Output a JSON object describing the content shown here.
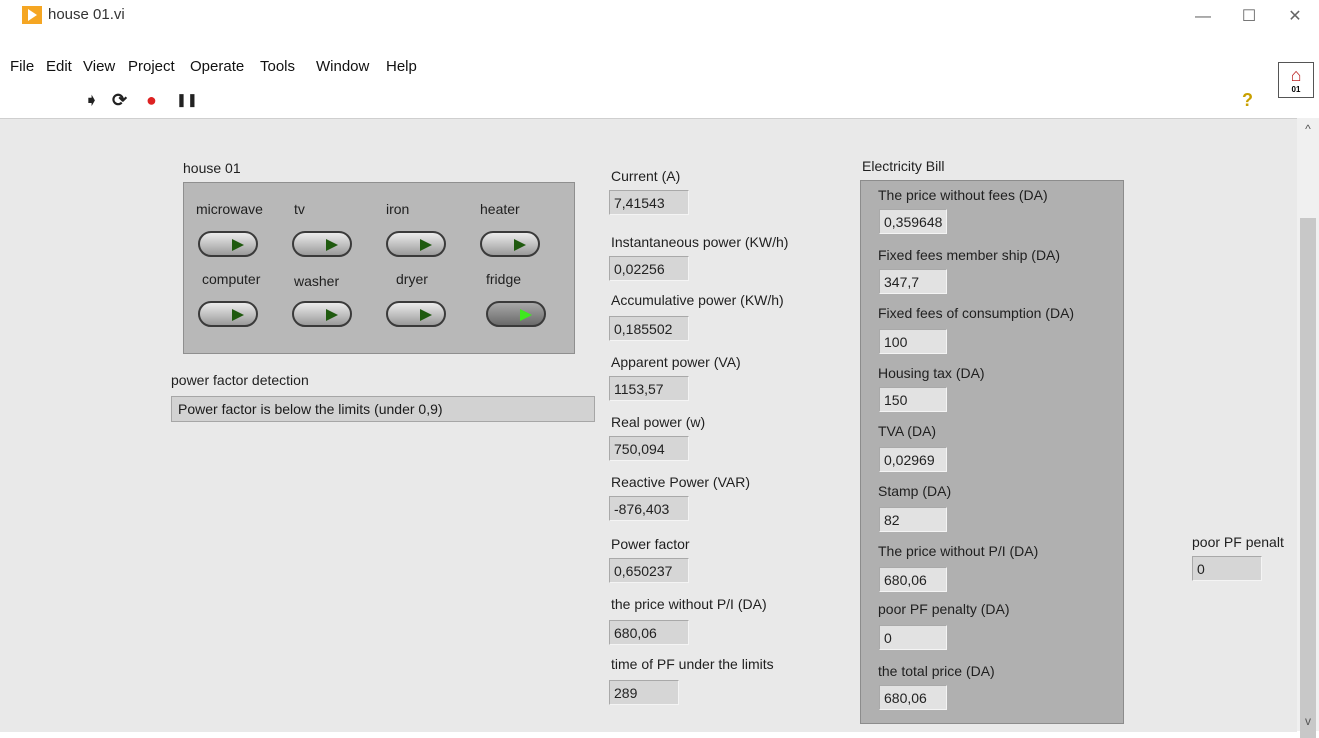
{
  "window": {
    "title": "house 01.vi",
    "minimize": "—",
    "maximize": "☐",
    "close": "✕"
  },
  "menu": [
    "File",
    "Edit",
    "View",
    "Project",
    "Operate",
    "Tools",
    "Window",
    "Help"
  ],
  "toolbar": {
    "run": "➧",
    "run_continuous": "⟳",
    "abort": "●",
    "pause": "❚❚",
    "help": "?"
  },
  "vi_icon": {
    "glyph": "⌂",
    "label": "01"
  },
  "house": {
    "title": "house 01",
    "appliances": [
      {
        "name": "microwave",
        "on": false
      },
      {
        "name": "tv",
        "on": false
      },
      {
        "name": "iron",
        "on": false
      },
      {
        "name": "heater",
        "on": false
      },
      {
        "name": "computer",
        "on": false
      },
      {
        "name": "washer",
        "on": false
      },
      {
        "name": "dryer",
        "on": false
      },
      {
        "name": "fridge",
        "on": true
      }
    ]
  },
  "pf_detection": {
    "label": "power factor detection",
    "value": "Power factor is below the limits (under 0,9)"
  },
  "measurements": [
    {
      "label": "Current (A)",
      "value": "7,41543"
    },
    {
      "label": "Instantaneous power (KW/h)",
      "value": "0,02256"
    },
    {
      "label": "Accumulative power (KW/h)",
      "value": "0,185502"
    },
    {
      "label": "Apparent power (VA)",
      "value": "1153,57"
    },
    {
      "label": "Real power (w)",
      "value": "750,094"
    },
    {
      "label": "Reactive Power (VAR)",
      "value": "-876,403"
    },
    {
      "label": "Power factor",
      "value": "0,650237"
    },
    {
      "label": "the price without P/I (DA)",
      "value": "680,06"
    },
    {
      "label": "time of PF under the limits",
      "value": "289"
    }
  ],
  "bill": {
    "title": "Electricity Bill",
    "items": [
      {
        "label": "The price without fees  (DA)",
        "value": "0,359648"
      },
      {
        "label": "Fixed fees member ship (DA)",
        "value": "347,7"
      },
      {
        "label": "Fixed fees of consumption (DA)",
        "value": "100"
      },
      {
        "label": "Housing tax (DA)",
        "value": "150"
      },
      {
        "label": "TVA (DA)",
        "value": "0,02969"
      },
      {
        "label": "Stamp (DA)",
        "value": "82"
      },
      {
        "label": "The price without P/I (DA)",
        "value": "680,06"
      },
      {
        "label": "poor PF penalty (DA)",
        "value": "0"
      },
      {
        "label": "the total price (DA)",
        "value": "680,06"
      }
    ]
  },
  "penalty": {
    "label": "poor PF penalt",
    "value": "0"
  },
  "scroll": {
    "up": "^",
    "down": "v"
  }
}
